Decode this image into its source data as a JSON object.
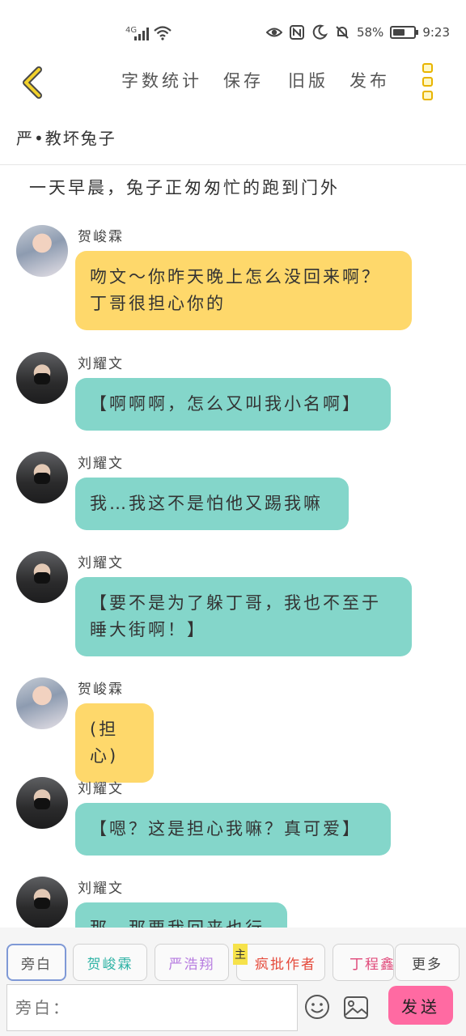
{
  "status_bar": {
    "network": "4G",
    "battery_percent": "58%",
    "time": "9:23"
  },
  "nav": {
    "back_icon": "chevron-left-icon",
    "word_count": "字数统计",
    "save": "保存",
    "old_version": "旧版",
    "publish": "发布",
    "more_icon": "more-vertical-icon",
    "accent_color": "#e8b400"
  },
  "story_title": "严•教坏兔子",
  "narration": "一天早晨，兔子正匆匆忙的跑到门外",
  "messages": [
    {
      "sender": "贺峻霖",
      "text_lines": [
        "吻文～你昨天晚上怎么没回来啊？",
        "丁哥很担心你的"
      ],
      "color": "#fed86b"
    },
    {
      "sender": "刘耀文",
      "text_lines": [
        "【啊啊啊，怎么又叫我小名啊】"
      ],
      "color": "#84d6ca"
    },
    {
      "sender": "刘耀文",
      "text_lines": [
        "我…我这不是怕他又踢我嘛"
      ],
      "color": "#84d6ca"
    },
    {
      "sender": "刘耀文",
      "text_lines": [
        "【要不是为了躲丁哥，我也不至于",
        "睡大街啊！】"
      ],
      "color": "#84d6ca"
    },
    {
      "sender": "贺峻霖",
      "text_lines": [
        "(担心)"
      ],
      "color": "#fed86b"
    },
    {
      "sender": "刘耀文",
      "text_lines": [
        "【嗯？这是担心我嘛？真可爱】"
      ],
      "color": "#84d6ca"
    },
    {
      "sender": "刘耀文",
      "text_lines": [
        "那…那要我回来也行"
      ],
      "color": "#84d6ca"
    }
  ],
  "roles": {
    "narrator": "旁白",
    "he": "贺峻霖",
    "yan": "严浩翔",
    "author": "疯批作者",
    "author_badge": "主",
    "ding": "丁程鑫",
    "more": "更多"
  },
  "input": {
    "placeholder": "旁白：",
    "send": "发送",
    "emoji_icon": "smiley-icon",
    "image_icon": "image-icon"
  }
}
